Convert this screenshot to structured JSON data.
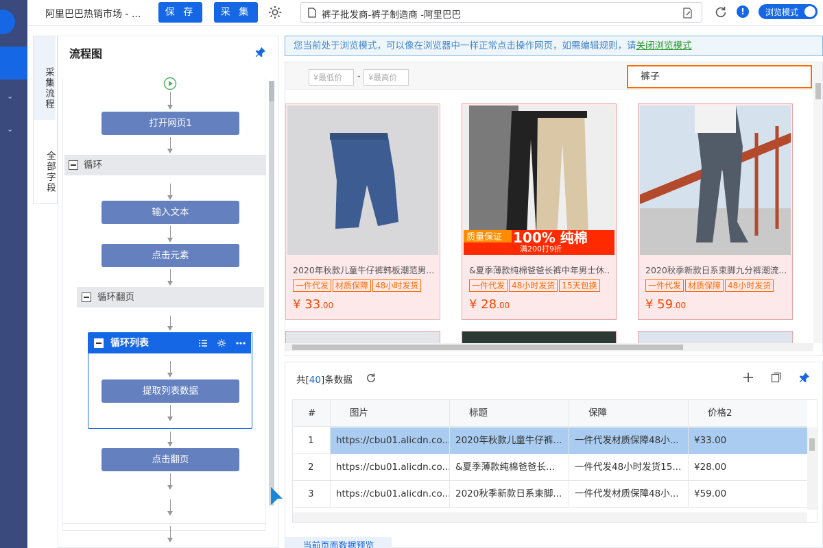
{
  "topbar": {
    "app_title": "阿里巴巴热销市场 - ...",
    "save_label": "保 存",
    "collect_label": "采 集",
    "url": "裤子批发商-裤子制造商 -阿里巴巴",
    "toggle_label": "浏览模式",
    "info_glyph": "!"
  },
  "sidetabs": [
    "采集流程",
    "全部字段"
  ],
  "flow": {
    "title": "流程图",
    "nodes": {
      "open_page": "打开网页1",
      "loop": "循环",
      "input_text": "输入文本",
      "click_element": "点击元素",
      "loop_paging": "循环翻页",
      "loop_list": "循环列表",
      "extract_list": "提取列表数据",
      "click_next": "点击翻页"
    }
  },
  "notice": {
    "text": "您当前处于浏览模式，可以像在浏览器中一样正常点击操作网页，如需编辑规则，请",
    "link": "关闭浏览模式"
  },
  "webview": {
    "price_min_placeholder": "¥最低价",
    "price_max_placeholder": "¥最高价",
    "price_sep": "-",
    "search_value": "裤子",
    "products": [
      {
        "title": "2020年秋款儿童牛仔裤韩板潮范男...",
        "tags": [
          "一件代发",
          "材质保障",
          "48小时发货"
        ],
        "price": "¥ 33",
        "cents": ".00"
      },
      {
        "title": "&夏季薄款纯棉爸爸长裤中年男士休...",
        "tags": [
          "一件代发",
          "48小时发货",
          "15天包换"
        ],
        "price": "¥ 28",
        "cents": ".00",
        "banner1": "质量保证",
        "banner2": "100% 纯棉",
        "banner3": "满200打9折"
      },
      {
        "title": "2020秋季新款日系束脚九分裤潮流...",
        "tags": [
          "一件代发",
          "材质保障",
          "48小时发货"
        ],
        "price": "¥ 59",
        "cents": ".00"
      }
    ]
  },
  "data": {
    "count_prefix": "共[",
    "count": "40",
    "count_suffix": "]条数据",
    "columns": [
      "#",
      "图片",
      "标题",
      "保障",
      "价格2"
    ],
    "rows": [
      {
        "n": "1",
        "img": "https://cbu01.alicdn.co...",
        "title": "2020年秋款儿童牛仔裤...",
        "guarantee": "一件代发材质保障48小...",
        "price": "¥33.00"
      },
      {
        "n": "2",
        "img": "https://cbu01.alicdn.co...",
        "title": "&夏季薄款纯棉爸爸长...",
        "guarantee": "一件代发48小时发货15...",
        "price": "¥28.00"
      },
      {
        "n": "3",
        "img": "https://cbu01.alicdn.co...",
        "title": "2020秋季新款日系束脚...",
        "guarantee": "一件代发材质保障48小...",
        "price": "¥59.00"
      }
    ],
    "preview_tab": "当前页面数据预览"
  },
  "colors": {
    "accent": "#1667e6",
    "node": "#6580bf",
    "price": "#ff4400",
    "tag": "#ff6a00",
    "rail": "#3a4a7c"
  }
}
